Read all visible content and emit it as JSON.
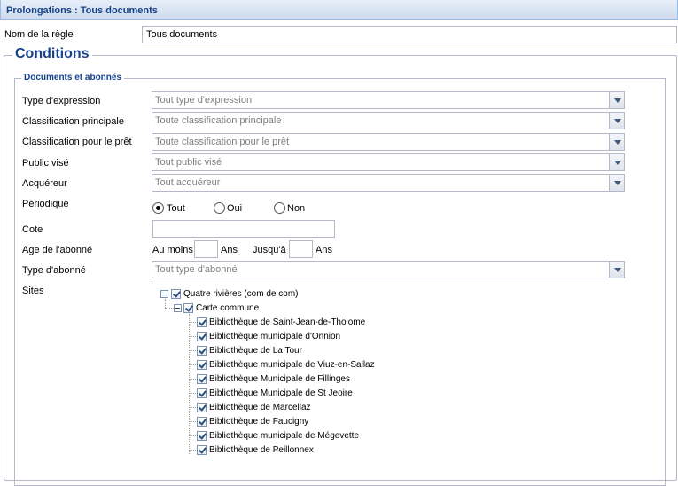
{
  "panel": {
    "title": "Prolongations : Tous documents"
  },
  "rule": {
    "label": "Nom de la règle",
    "value": "Tous documents"
  },
  "conditions": {
    "legend": "Conditions",
    "section_legend": "Documents et abonnés",
    "fields": {
      "type_expression": {
        "label": "Type d'expression",
        "placeholder": "Tout type d'expression"
      },
      "classification_principale": {
        "label": "Classification principale",
        "placeholder": "Toute classification principale"
      },
      "classification_pret": {
        "label": "Classification pour le prêt",
        "placeholder": "Toute classification pour le prêt"
      },
      "public_vise": {
        "label": "Public visé",
        "placeholder": "Tout public visé"
      },
      "acquereur": {
        "label": "Acquéreur",
        "placeholder": "Tout acquéreur"
      },
      "periodique": {
        "label": "Périodique",
        "options": [
          "Tout",
          "Oui",
          "Non"
        ],
        "selected": "Tout"
      },
      "cote": {
        "label": "Cote",
        "value": ""
      },
      "age": {
        "label": "Age de l'abonné",
        "min_label": "Au moins",
        "min_unit": "Ans",
        "max_label": "Jusqu'à",
        "max_unit": "Ans"
      },
      "type_abonne": {
        "label": "Type d'abonné",
        "placeholder": "Tout type d'abonné"
      },
      "sites": {
        "label": "Sites",
        "root": "Quatre rivières (com de com)",
        "group": "Carte commune",
        "items": [
          "Bibliothèque de Saint-Jean-de-Tholome",
          "Bibliothèque municipale d'Onnion",
          "Bibliothèque de La Tour",
          "Bibliothèque municipale de Viuz-en-Sallaz",
          "Bibliothèque Municipale de Fillinges",
          "Bibliothèque Municipale de St Jeoire",
          "Bibliothèque de Marcellaz",
          "Bibliothèque de Faucigny",
          "Bibliothèque municipale de Mégevette",
          "Bibliothèque de Peillonnex"
        ]
      }
    }
  },
  "icons": {
    "combo_trigger": "chevron-down-icon",
    "tree_toggle": "collapse-icon",
    "checkbox": "checkbox-checked-icon"
  },
  "colors": {
    "accent": "#15428b",
    "border": "#b5b8c8",
    "header_bg": "#dfe8f6"
  }
}
